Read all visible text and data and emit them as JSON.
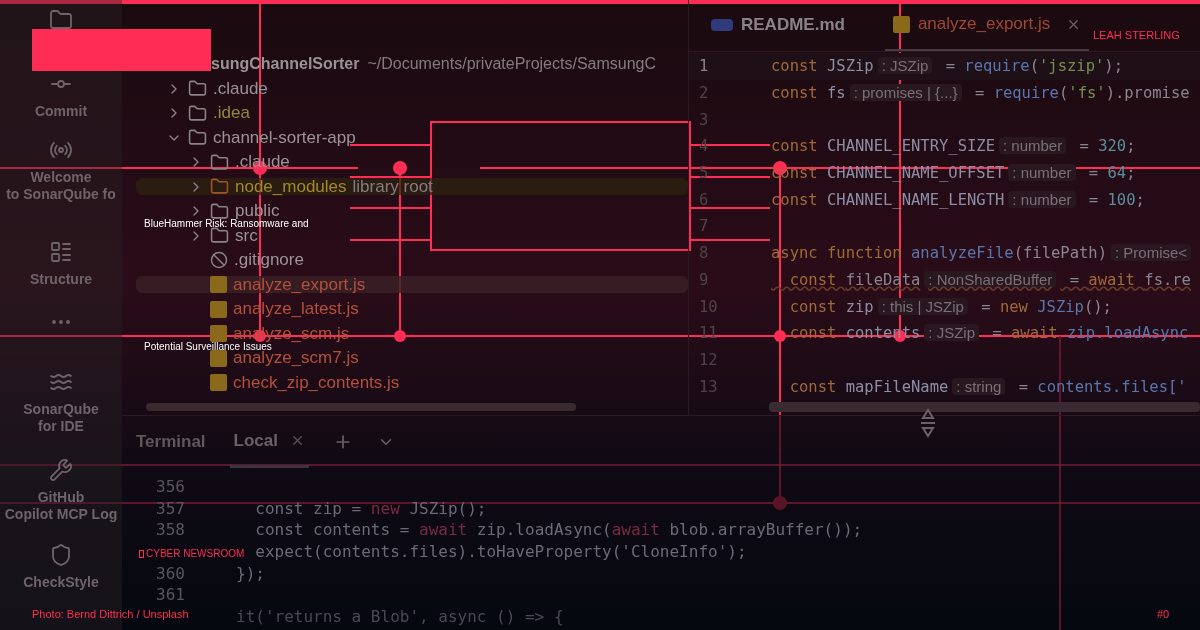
{
  "activity_bar": [
    {
      "kind": "folder"
    },
    {
      "kind": "commit",
      "label": "Commit"
    },
    {
      "kind": "welcome",
      "label": "Welcome\nto SonarQube fo"
    },
    {
      "kind": "structure",
      "label": "Structure"
    },
    {
      "kind": "more"
    },
    {
      "kind": "sonar",
      "label": "SonarQube\nfor IDE"
    },
    {
      "kind": "tools",
      "label": "GitHub\nCopilot MCP Log"
    },
    {
      "kind": "checkstyle",
      "label": "CheckStyle"
    }
  ],
  "project": {
    "root": {
      "name": "sungChannelSorter",
      "path": "~/Documents/privateProjects/SamsungC"
    },
    "tree": [
      {
        "name": ".claude",
        "kind": "folder",
        "expanded": false,
        "selected": false,
        "color": "#9b9398"
      },
      {
        "name": ".idea",
        "kind": "folder",
        "expanded": false,
        "selected": false,
        "color": "#8f8a3c"
      },
      {
        "name": "channel-sorter-app",
        "kind": "folder",
        "expanded": true,
        "selected": false,
        "color": "#9b9398",
        "children": [
          {
            "name": ".claude",
            "kind": "folder",
            "expanded": false,
            "selected": false,
            "color": "#9b9398"
          },
          {
            "name": "node_modules",
            "note": "library root",
            "kind": "library",
            "expanded": false,
            "selected": false,
            "color": "#a08a2c"
          },
          {
            "name": "public",
            "kind": "folder",
            "expanded": false,
            "selected": false,
            "color": "#9b9398"
          },
          {
            "name": "src",
            "kind": "folder",
            "expanded": false,
            "selected": false,
            "color": "#9b9398"
          },
          {
            "name": ".gitignore",
            "kind": "ignore",
            "selected": false,
            "color": "#9b9398"
          },
          {
            "name": "analyze_export.js",
            "kind": "js",
            "selected": true,
            "color": "#b4503c"
          },
          {
            "name": "analyze_latest.js",
            "kind": "js",
            "selected": false,
            "color": "#b4503c"
          },
          {
            "name": "analyze_scm.js",
            "kind": "js",
            "selected": false,
            "color": "#b4503c"
          },
          {
            "name": "analyze_scm7.js",
            "kind": "js",
            "selected": false,
            "color": "#b4503c"
          },
          {
            "name": "check_zip_contents.js",
            "kind": "js",
            "selected": false,
            "color": "#b4503c"
          }
        ]
      }
    ]
  },
  "editor": {
    "tabs": [
      {
        "label": "README.md",
        "kind": "md",
        "selected": false
      },
      {
        "label": "analyze_export.js",
        "kind": "js",
        "selected": true
      }
    ],
    "lines": [
      {
        "number": "1",
        "current": true,
        "warning": false,
        "segments": [
          {
            "text": "const ",
            "kind": "keyword"
          },
          {
            "text": "JSZip",
            "kind": "ident"
          },
          {
            "text": ": JSZip",
            "kind": "hint"
          },
          {
            "text": " = ",
            "kind": "plain"
          },
          {
            "text": "require",
            "kind": "fn"
          },
          {
            "text": "(",
            "kind": "plain"
          },
          {
            "text": "'jszip'",
            "kind": "string"
          },
          {
            "text": ");",
            "kind": "plain"
          }
        ]
      },
      {
        "number": "2",
        "current": false,
        "warning": false,
        "segments": [
          {
            "text": "const ",
            "kind": "keyword"
          },
          {
            "text": "fs",
            "kind": "ident"
          },
          {
            "text": ": promises | {...}",
            "kind": "hint"
          },
          {
            "text": " = ",
            "kind": "plain"
          },
          {
            "text": "require",
            "kind": "fn"
          },
          {
            "text": "(",
            "kind": "plain"
          },
          {
            "text": "'fs'",
            "kind": "string"
          },
          {
            "text": ").promise",
            "kind": "plain"
          }
        ]
      },
      {
        "number": "3",
        "current": false
      },
      {
        "number": "4",
        "current": false,
        "warning": false,
        "segments": [
          {
            "text": "const ",
            "kind": "keyword"
          },
          {
            "text": "CHANNEL_ENTRY_SIZE",
            "kind": "ident"
          },
          {
            "text": ": number",
            "kind": "hint"
          },
          {
            "text": " = ",
            "kind": "plain"
          },
          {
            "text": "320",
            "kind": "number"
          },
          {
            "text": ";",
            "kind": "plain"
          }
        ]
      },
      {
        "number": "5",
        "current": false,
        "warning": false,
        "segments": [
          {
            "text": "const ",
            "kind": "keyword"
          },
          {
            "text": "CHANNEL_NAME_OFFSET",
            "kind": "ident"
          },
          {
            "text": ": number",
            "kind": "hint"
          },
          {
            "text": " = ",
            "kind": "plain"
          },
          {
            "text": "64",
            "kind": "number"
          },
          {
            "text": ";",
            "kind": "plain"
          }
        ]
      },
      {
        "number": "6",
        "current": false,
        "warning": false,
        "segments": [
          {
            "text": "const ",
            "kind": "keyword"
          },
          {
            "text": "CHANNEL_NAME_LENGTH",
            "kind": "ident"
          },
          {
            "text": ": number",
            "kind": "hint"
          },
          {
            "text": " = ",
            "kind": "plain"
          },
          {
            "text": "100",
            "kind": "number"
          },
          {
            "text": ";",
            "kind": "plain"
          }
        ]
      },
      {
        "number": "7",
        "current": false
      },
      {
        "number": "8",
        "current": false,
        "warning": false,
        "segments": [
          {
            "text": "async function ",
            "kind": "keyword"
          },
          {
            "text": "analyzeFile",
            "kind": "fn"
          },
          {
            "text": "(filePath)",
            "kind": "plain"
          },
          {
            "text": ": Promise<",
            "kind": "hint"
          }
        ]
      },
      {
        "number": "9",
        "current": false,
        "warning": true,
        "segments": [
          {
            "text": "  const ",
            "kind": "keyword"
          },
          {
            "text": "fileData",
            "kind": "plain"
          },
          {
            "text": ": NonSharedBuffer",
            "kind": "hint"
          },
          {
            "text": " = ",
            "kind": "plain"
          },
          {
            "text": "await ",
            "kind": "keyword"
          },
          {
            "text": "fs.re",
            "kind": "plain"
          }
        ]
      },
      {
        "number": "10",
        "current": false,
        "warning": false,
        "segments": [
          {
            "text": "  const ",
            "kind": "keyword"
          },
          {
            "text": "zip",
            "kind": "ident"
          },
          {
            "text": ": this | JSZip",
            "kind": "hint"
          },
          {
            "text": " = ",
            "kind": "plain"
          },
          {
            "text": "new ",
            "kind": "keyword"
          },
          {
            "text": "JSZip",
            "kind": "fn"
          },
          {
            "text": "();",
            "kind": "plain"
          }
        ]
      },
      {
        "number": "11",
        "current": false,
        "warning": false,
        "segments": [
          {
            "text": "  const ",
            "kind": "keyword"
          },
          {
            "text": "contents",
            "kind": "ident"
          },
          {
            "text": ": JSZip",
            "kind": "hint"
          },
          {
            "text": " = ",
            "kind": "plain"
          },
          {
            "text": "await ",
            "kind": "keyword"
          },
          {
            "text": "zip.loadAsync",
            "kind": "fn"
          }
        ]
      },
      {
        "number": "12",
        "current": false
      },
      {
        "number": "13",
        "current": false,
        "warning": false,
        "segments": [
          {
            "text": "  const ",
            "kind": "keyword"
          },
          {
            "text": "mapFileName",
            "kind": "ident"
          },
          {
            "text": ": string",
            "kind": "hint"
          },
          {
            "text": " = ",
            "kind": "plain"
          },
          {
            "text": "contents.files['",
            "kind": "fn"
          }
        ]
      }
    ]
  },
  "terminal": {
    "title": "Terminal",
    "tabs": [
      {
        "label": "Local",
        "selected": true
      }
    ],
    "lines": [
      {
        "number": "356"
      },
      {
        "number": "357",
        "segments": [
          {
            "text": "  const zip = ",
            "kind": "plain"
          },
          {
            "text": "new ",
            "kind": "keyword"
          },
          {
            "text": "JSZip();",
            "kind": "plain"
          }
        ]
      },
      {
        "number": "358",
        "segments": [
          {
            "text": "  const contents = ",
            "kind": "plain"
          },
          {
            "text": "await ",
            "kind": "keyword"
          },
          {
            "text": "zip.loadAsync(",
            "kind": "plain"
          },
          {
            "text": "await ",
            "kind": "keyword"
          },
          {
            "text": "blob.arrayBuffer());",
            "kind": "plain"
          }
        ]
      },
      {
        "segments": [
          {
            "text": "  expect(contents.files).toHaveProperty('CloneInfo');",
            "kind": "plain"
          }
        ]
      },
      {
        "number": "360",
        "segments": [
          {
            "text": "});",
            "kind": "plain"
          }
        ]
      },
      {
        "number": "361"
      },
      {
        "segments": [
          {
            "text": "it('returns a Blob', async () => {",
            "kind": "faint"
          }
        ]
      }
    ]
  },
  "overlay": {
    "byline": "LEAH STERLING",
    "labels": [
      "BlueHammer Risk: Ransomware and",
      "Potential Surveillance Issues"
    ],
    "brand": "CYBER NEWSROOM",
    "credit": "Photo: Bernd Dittrich / Unsplash",
    "index": "#0"
  }
}
